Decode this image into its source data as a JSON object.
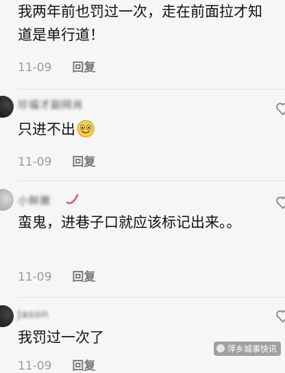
{
  "comments": [
    {
      "username": "",
      "text": "我两年前也罚过一次，走在前面拉才知道是单行道！",
      "date": "11-09",
      "reply_label": "回复"
    },
    {
      "username": "珍福才副网肖",
      "text": "只进不出",
      "emoji": "smiling-face-icon",
      "date": "11-09",
      "reply_label": "回复"
    },
    {
      "username": "小鲜嫩",
      "text": "蛮鬼，进巷子口就应该标记出来。。",
      "date": "11-09",
      "reply_label": "回复"
    },
    {
      "username": "Jason",
      "text": "我罚过一次了",
      "date": "11-09",
      "reply_label": "回复"
    }
  ],
  "watermark": "萍乡城事快讯",
  "colors": {
    "background": "#f6f6f6",
    "meta_text": "#9a9a9a",
    "heart_stroke": "#8a8a8a"
  }
}
